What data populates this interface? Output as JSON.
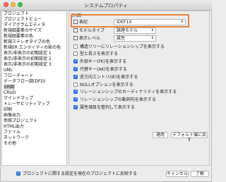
{
  "window": {
    "title": "システムプロパティ"
  },
  "sidebar": {
    "items": [
      {
        "label": "プロジェクト"
      },
      {
        "label": "プロジェクトビュー"
      },
      {
        "label": "ダイアグラムエディタ"
      },
      {
        "label": "新規図要素のサイズ"
      },
      {
        "label": "新規図要素の色"
      },
      {
        "label": "新規ステレオタイプの色"
      },
      {
        "label": "新規ER エンティティの影の色"
      },
      {
        "label": "表示/非表示の初期設定 1"
      },
      {
        "label": "表示/非表示の初期設定 2"
      },
      {
        "label": "表示/非表示の初期設定 3"
      },
      {
        "label": "UML"
      },
      {
        "label": "フローチャート"
      },
      {
        "label": "データフロー図(DFD)"
      },
      {
        "label": "ER図"
      },
      {
        "label": "CRUD"
      },
      {
        "label": "マインドマップ"
      },
      {
        "label": "トレーサビリティマップ"
      },
      {
        "label": "印刷"
      },
      {
        "label": "画像出力"
      },
      {
        "label": "参照プロジェクト"
      },
      {
        "label": "HTML出力"
      },
      {
        "label": "ファイル"
      },
      {
        "label": "ネットワーク"
      },
      {
        "label": "その他"
      }
    ],
    "selected_index": 13
  },
  "panel": {
    "title": "ER図",
    "notation_label": "表記",
    "notation_value": "IDEF1X",
    "model_type_label": "モデルタイプ",
    "model_type_value": "論理モデル",
    "display_level_label": "表示レベル",
    "display_level_value": "属性",
    "checkboxes": [
      {
        "label": "構造ツリーにリレーションシップを表示する",
        "checked": false
      },
      {
        "label": "型と長さを表示する",
        "checked": false
      },
      {
        "label": "外部キー(FK)を表示する",
        "checked": true
      },
      {
        "label": "代替キー(AK)を表示する",
        "checked": true
      },
      {
        "label": "逆方向エントリ(IE)を表示する",
        "checked": true
      },
      {
        "label": "NULLオプションを表示する",
        "checked": false
      },
      {
        "label": "リレーションシップのカーディナリティを表示する",
        "checked": true
      },
      {
        "label": "リレーションシップの動詞句を表示する",
        "checked": true
      },
      {
        "label": "属性項目を整列して表示する",
        "checked": true
      }
    ],
    "apply_label": "適用",
    "defaults_label": "デフォルト値に戻す"
  },
  "footer": {
    "reflect_label": "プロジェクトに関する設定を現在のプロジェクトに反映する",
    "reflect_checked": true,
    "cancel_label": "キャンセル",
    "ok_label": "了解"
  },
  "colors": {
    "accent": "#2a6fe8",
    "highlight": "#e8823a"
  }
}
